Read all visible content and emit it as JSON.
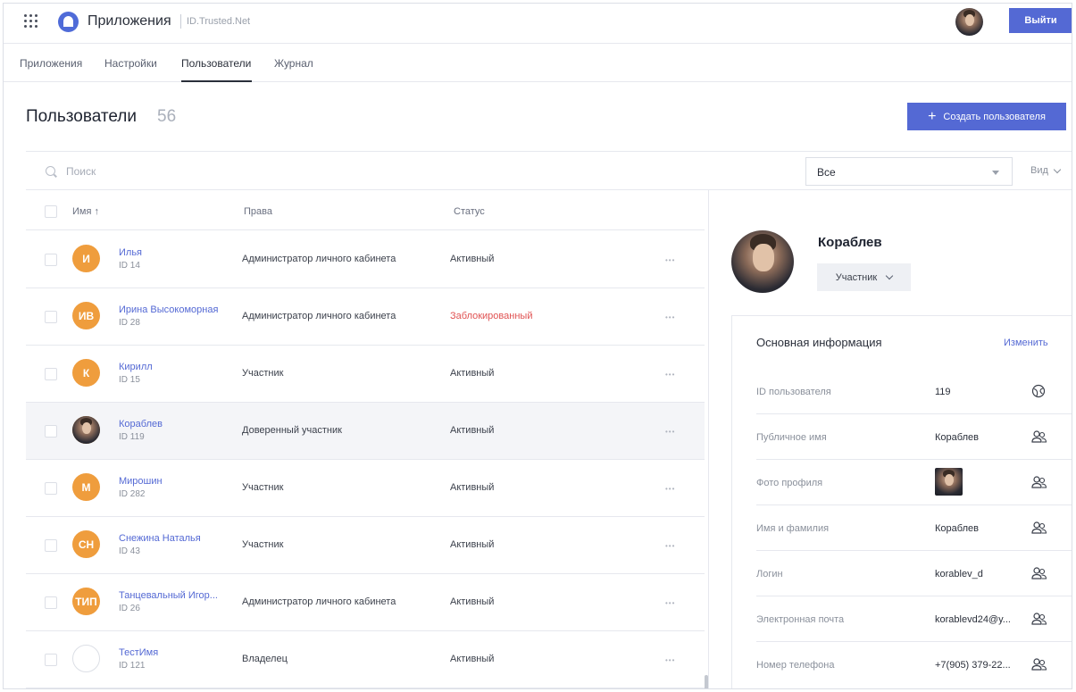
{
  "app": {
    "title": "Приложения",
    "subtitle": "ID.Trusted.Net",
    "logout_label": "Выйти",
    "accent_color": "#5469d4"
  },
  "tabs": [
    {
      "label": "Приложения",
      "active": false
    },
    {
      "label": "Настройки",
      "active": false
    },
    {
      "label": "Пользователи",
      "active": true
    },
    {
      "label": "Журнал",
      "active": false
    }
  ],
  "page": {
    "title": "Пользователи",
    "count": "56",
    "create_label": "Создать пользователя"
  },
  "search": {
    "placeholder": "Поиск",
    "filter_value": "Все",
    "view_label": "Вид"
  },
  "table": {
    "headers": {
      "name": "Имя ↑",
      "rights": "Права",
      "status": "Статус"
    },
    "rows": [
      {
        "initials": "И",
        "name": "Илья",
        "id": "ID 14",
        "role": "Администратор личного кабинета",
        "status": "Активный",
        "blocked": false,
        "photo": false,
        "empty": false
      },
      {
        "initials": "ИВ",
        "name": "Ирина Высокоморная",
        "id": "ID 28",
        "role": "Администратор личного кабинета",
        "status": "Заблокированный",
        "blocked": true,
        "photo": false,
        "empty": false
      },
      {
        "initials": "К",
        "name": "Кирилл",
        "id": "ID 15",
        "role": "Участник",
        "status": "Активный",
        "blocked": false,
        "photo": false,
        "empty": false
      },
      {
        "initials": "",
        "name": "Кораблев",
        "id": "ID 119",
        "role": "Доверенный участник",
        "status": "Активный",
        "blocked": false,
        "photo": true,
        "empty": false,
        "selected": true
      },
      {
        "initials": "М",
        "name": "Мирошин",
        "id": "ID 282",
        "role": "Участник",
        "status": "Активный",
        "blocked": false,
        "photo": false,
        "empty": false
      },
      {
        "initials": "СН",
        "name": "Снежина Наталья",
        "id": "ID 43",
        "role": "Участник",
        "status": "Активный",
        "blocked": false,
        "photo": false,
        "empty": false
      },
      {
        "initials": "ТИП",
        "name": "Танцевальный Игор...",
        "id": "ID 26",
        "role": "Администратор личного кабинета",
        "status": "Активный",
        "blocked": false,
        "photo": false,
        "empty": false
      },
      {
        "initials": "",
        "name": "ТестИмя",
        "id": "ID 121",
        "role": "Владелец",
        "status": "Активный",
        "blocked": false,
        "photo": false,
        "empty": true
      }
    ]
  },
  "profile": {
    "name": "Кораблев",
    "role_label": "Участник",
    "card_title": "Основная информация",
    "edit_label": "Изменить",
    "fields": [
      {
        "label": "ID пользователя",
        "value": "119",
        "icon": "globe-icon"
      },
      {
        "label": "Публичное имя",
        "value": "Кораблев",
        "icon": "users-icon"
      },
      {
        "label": "Фото профиля",
        "value": "",
        "icon": "users-icon",
        "thumb": true
      },
      {
        "label": "Имя и фамилия",
        "value": "Кораблев",
        "icon": "users-icon"
      },
      {
        "label": "Логин",
        "value": "korablev_d",
        "icon": "users-icon"
      },
      {
        "label": "Электронная почта",
        "value": "korablevd24@y...",
        "icon": "users-icon"
      },
      {
        "label": "Номер телефона",
        "value": "+7(905) 379-22...",
        "icon": "users-icon"
      }
    ]
  }
}
